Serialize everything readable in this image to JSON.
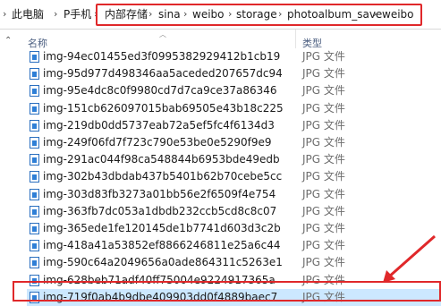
{
  "breadcrumb": {
    "items": [
      {
        "label": "此电脑"
      },
      {
        "label": "P手机"
      },
      {
        "label": "内部存储"
      },
      {
        "label": "sina"
      },
      {
        "label": "weibo"
      },
      {
        "label": "storage"
      },
      {
        "label": "photoalbum_save"
      },
      {
        "label": "weibo"
      }
    ],
    "separator": "›"
  },
  "columns": {
    "name": "名称",
    "type": "类型"
  },
  "files": [
    {
      "name": "img-94ec01455ed3f0995382929412b1cb19",
      "type": "JPG 文件"
    },
    {
      "name": "img-95d977d498346aa5aceded207657dc94",
      "type": "JPG 文件"
    },
    {
      "name": "img-95e4dc8c0f9980cd7d7ca9ce37a86346",
      "type": "JPG 文件"
    },
    {
      "name": "img-151cb626097015bab69505e43b18c225",
      "type": "JPG 文件"
    },
    {
      "name": "img-219db0dd5737eab72a5ef5fc4f6134d3",
      "type": "JPG 文件"
    },
    {
      "name": "img-249f06fd7f723c790e53be0e5290f9e9",
      "type": "JPG 文件"
    },
    {
      "name": "img-291ac044f98ca548844b6953bde49edb",
      "type": "JPG 文件"
    },
    {
      "name": "img-302b43dbdab437b5401b62b70cebe5cc",
      "type": "JPG 文件"
    },
    {
      "name": "img-303d83fb3273a01bb56e2f6509f4e754",
      "type": "JPG 文件"
    },
    {
      "name": "img-363fb7dc053a1dbdb232ccb5cd8c8c07",
      "type": "JPG 文件"
    },
    {
      "name": "img-365ede1fe120145de1b7741d603d3c2b",
      "type": "JPG 文件"
    },
    {
      "name": "img-418a41a53852ef8866246811e25a6c44",
      "type": "JPG 文件"
    },
    {
      "name": "img-590c64a2049656a0ade864311c5263e1",
      "type": "JPG 文件"
    },
    {
      "name": "img-628beb71adf40ff75004e9224917365a",
      "type": "JPG 文件"
    },
    {
      "name": "img-719f0ab4b9dbe409903dd0f4889baec7",
      "type": "JPG 文件",
      "selected": true
    }
  ],
  "colors": {
    "highlight": "#e0282a",
    "selection": "#cce8ff",
    "header_text": "#4d6082"
  }
}
